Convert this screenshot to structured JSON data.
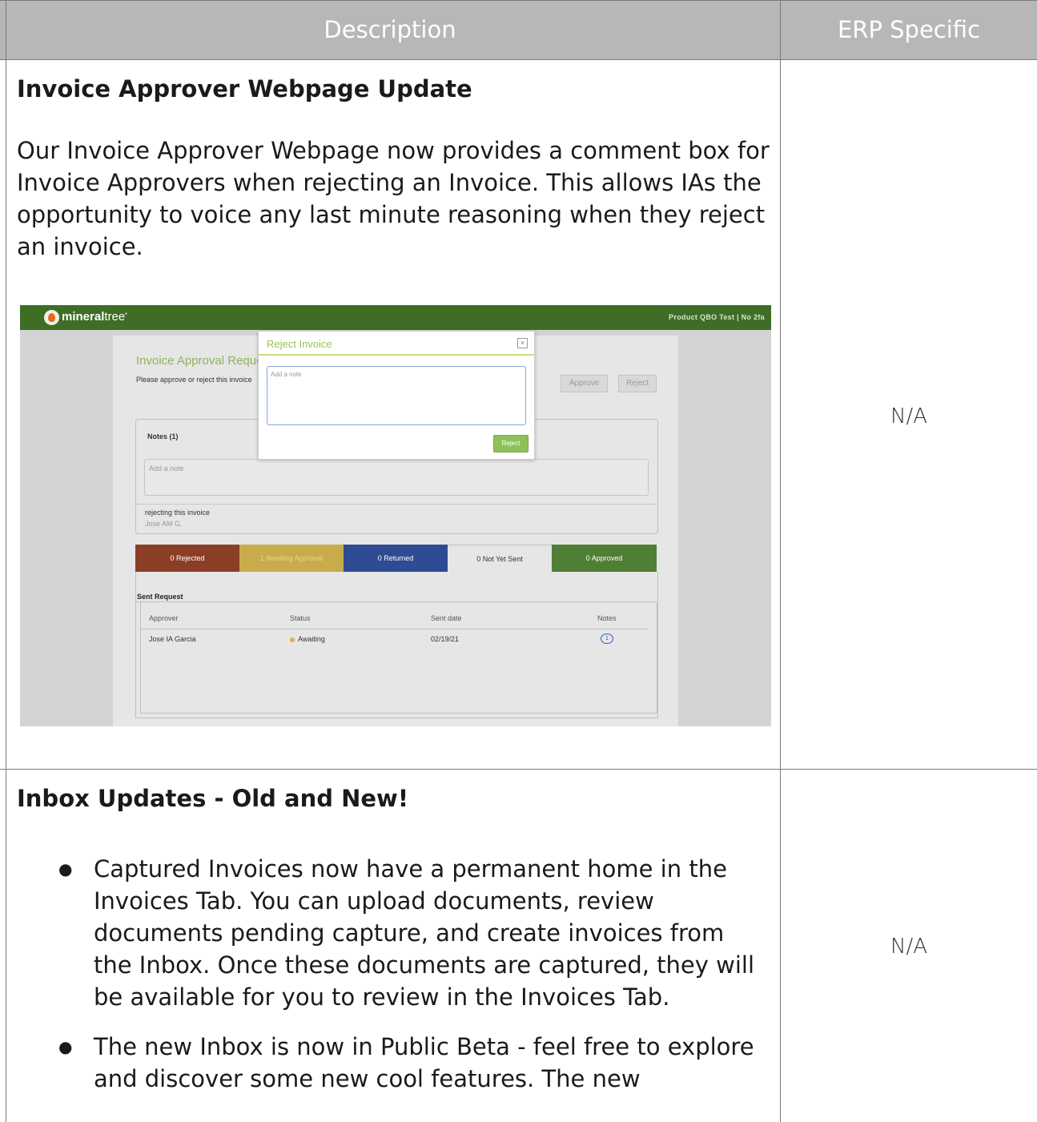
{
  "header": {
    "description": "Description",
    "erp_specific": "ERP Specific"
  },
  "rows": [
    {
      "title": "Invoice Approver Webpage Update",
      "paragraph": "Our Invoice Approver Webpage now provides a comment box for Invoice Approvers when rejecting an Invoice. This allows IAs the opportunity to voice any last minute reasoning when they reject an invoice.",
      "erp": "N/A"
    },
    {
      "title": "Inbox Updates - Old and New!",
      "bullets": [
        "Captured Invoices now have a permanent home in the Invoices Tab. You can upload documents, review documents pending capture, and create invoices from the Inbox. Once these documents are captured, they will be available for you to review in the Invoices Tab.",
        "The new Inbox is now in Public Beta - feel free to explore and discover some new cool features. The new"
      ],
      "erp": "N/A"
    }
  ],
  "screenshot": {
    "brand_prefix": "mineral",
    "brand_suffix": "tree",
    "brand_mark": "•",
    "account": "Product QBO Test | No 2fa",
    "page_title": "Invoice Approval Reque",
    "page_subtitle": "Please approve or reject this invoice",
    "approve_label": "Approve",
    "reject_label": "Reject",
    "notes_title": "Notes (1)",
    "note_placeholder": "Add a note",
    "note_text": "rejecting this invoice",
    "note_author": "Jose AM G.",
    "statuses": [
      {
        "label": "0 Rejected",
        "color": "#8b3e26"
      },
      {
        "label": "1 Awaiting Approval",
        "color": "#c8ac4c"
      },
      {
        "label": "0 Returned",
        "color": "#2f4b93"
      },
      {
        "label": "0 Not Yet Sent",
        "color": "#e6e6e6"
      },
      {
        "label": "0 Approved",
        "color": "#4e7f35"
      }
    ],
    "sent_request_title": "Sent Request",
    "columns": [
      "Approver",
      "Status",
      "Sent date",
      "Notes"
    ],
    "row": {
      "approver": "Jose IA Garcia",
      "status": "Awaiting",
      "sent_date": "02/19/21",
      "notes_count": "1"
    },
    "modal": {
      "title": "Reject Invoice",
      "close": "×",
      "placeholder": "Add a note",
      "button": "Reject"
    }
  }
}
